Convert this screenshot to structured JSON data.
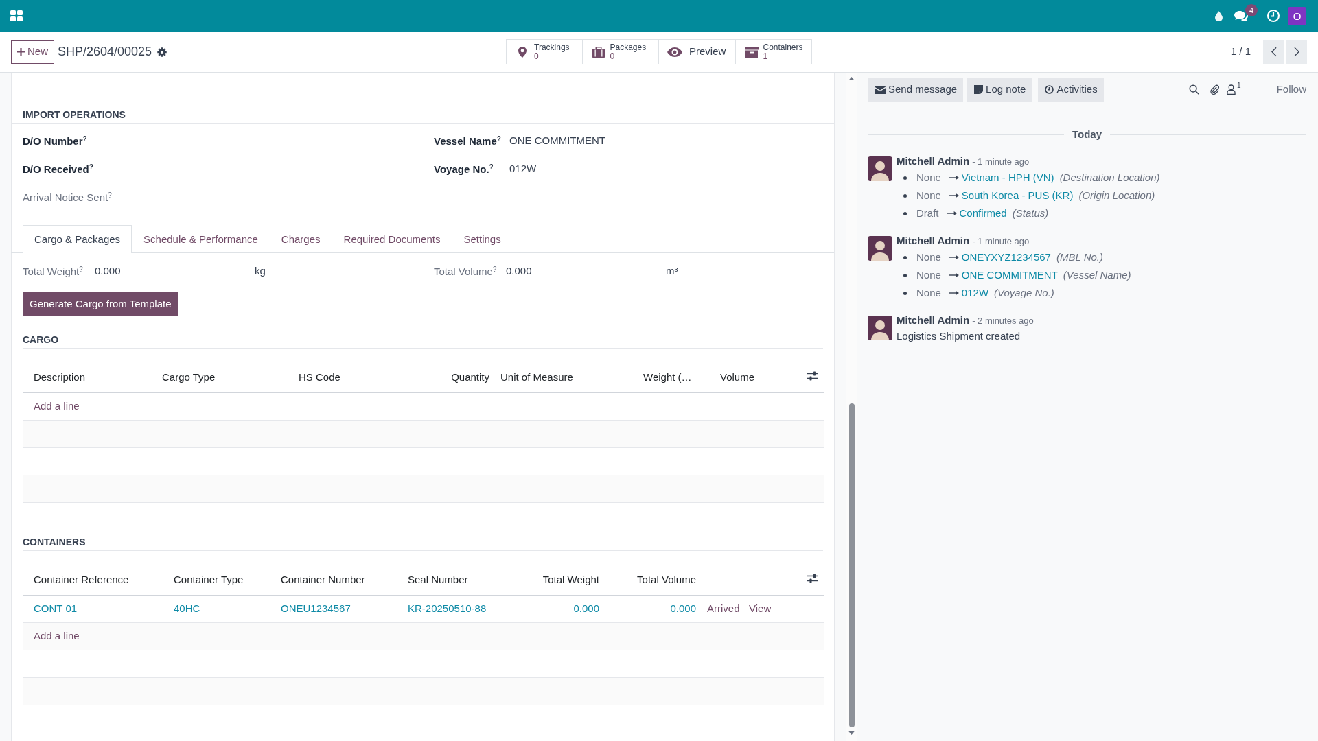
{
  "navbar": {
    "messages_badge": "4",
    "user_avatar": "O"
  },
  "control_panel": {
    "new_button": "New",
    "record_title": "SHP/2604/00025",
    "stat_buttons": [
      {
        "kind": "counter",
        "label": "Trackings",
        "value": "0"
      },
      {
        "kind": "counter",
        "label": "Packages",
        "value": "0"
      },
      {
        "kind": "action",
        "label": "Preview"
      },
      {
        "kind": "counter",
        "label": "Containers",
        "value": "1"
      }
    ],
    "pager": "1 / 1"
  },
  "form": {
    "import_operations": {
      "title": "IMPORT OPERATIONS",
      "left_fields": [
        {
          "label": "D/O Number$^{?}$",
          "readonly": false
        },
        {
          "label": "D/O Received$^{?}$",
          "readonly": false
        },
        {
          "label": "Arrival Notice Sent$^{?}$",
          "readonly": true
        }
      ],
      "right_fields": [
        {
          "label": "Vessel Name$^{?}$",
          "value": "ONE COMMITMENT",
          "readonly": false
        },
        {
          "label": "Voyage No.$^{?}$",
          "value": "012W",
          "readonly": false
        }
      ]
    },
    "tabs": [
      {
        "label": "Cargo & Packages",
        "selected": true
      },
      {
        "label": "Schedule & Performance",
        "selected": false
      },
      {
        "label": "Charges",
        "selected": false
      },
      {
        "label": "Required Documents",
        "selected": false
      },
      {
        "label": "Settings",
        "selected": false
      }
    ],
    "totals": [
      {
        "label": "Total Weight$^{?}$",
        "value": "0.000",
        "unit": "kg",
        "readonly": true
      },
      {
        "label": "Total Volume$^{?}$",
        "value": "0.000",
        "unit": "m³",
        "readonly": true
      }
    ],
    "generate_button": "Generate Cargo from Template",
    "cargo": {
      "title": "CARGO",
      "columns": [
        {
          "label": "Description",
          "kind": "text"
        },
        {
          "label": "Cargo Type",
          "kind": "text"
        },
        {
          "label": "HS Code",
          "kind": "text"
        },
        {
          "label": "Quantity",
          "kind": "number"
        },
        {
          "label": "Unit of Measure",
          "kind": "text"
        },
        {
          "label": "Weight (…",
          "kind": "text"
        },
        {
          "label": "Volume",
          "kind": "text"
        }
      ],
      "add_line": "Add a line"
    },
    "containers": {
      "title": "CONTAINERS",
      "columns": [
        {
          "label": "Container Reference",
          "kind": "text"
        },
        {
          "label": "Container Type",
          "kind": "text"
        },
        {
          "label": "Container Number",
          "kind": "text"
        },
        {
          "label": "Seal Number",
          "kind": "text"
        },
        {
          "label": "Total Weight",
          "kind": "number"
        },
        {
          "label": "Total Volume",
          "kind": "number"
        }
      ],
      "rows": [
        {
          "cells": [
            "CONT 01",
            "40HC",
            "ONEU1234567",
            "KR-20250510-88",
            "0.000",
            "0.000"
          ],
          "status": "Arrived",
          "action": "View"
        }
      ],
      "add_line": "Add a line"
    }
  },
  "chatter": {
    "buttons": [
      "Send message",
      "Log note",
      "Activities"
    ],
    "followers": "1",
    "follow": "Follow",
    "day_divider": "Today",
    "messages": [
      {
        "author": "Mitchell Admin",
        "time": "- 1 minute ago",
        "changes": [
          {
            "old": "None",
            "new": "Vietnam - HPH (VN)",
            "field": "(Destination Location)"
          },
          {
            "old": "None",
            "new": "South Korea - PUS (KR)",
            "field": "(Origin Location)"
          },
          {
            "old": "Draft",
            "new": "Confirmed",
            "field": "(Status)"
          }
        ]
      },
      {
        "author": "Mitchell Admin",
        "time": "- 1 minute ago",
        "changes": [
          {
            "old": "None",
            "new": "ONEYXYZ1234567",
            "field": "(MBL No.)"
          },
          {
            "old": "None",
            "new": "ONE COMMITMENT",
            "field": "(Vessel Name)"
          },
          {
            "old": "None",
            "new": "012W",
            "field": "(Voyage No.)"
          }
        ]
      },
      {
        "author": "Mitchell Admin",
        "time": "- 2 minutes ago",
        "body": "Logistics Shipment created"
      }
    ]
  }
}
